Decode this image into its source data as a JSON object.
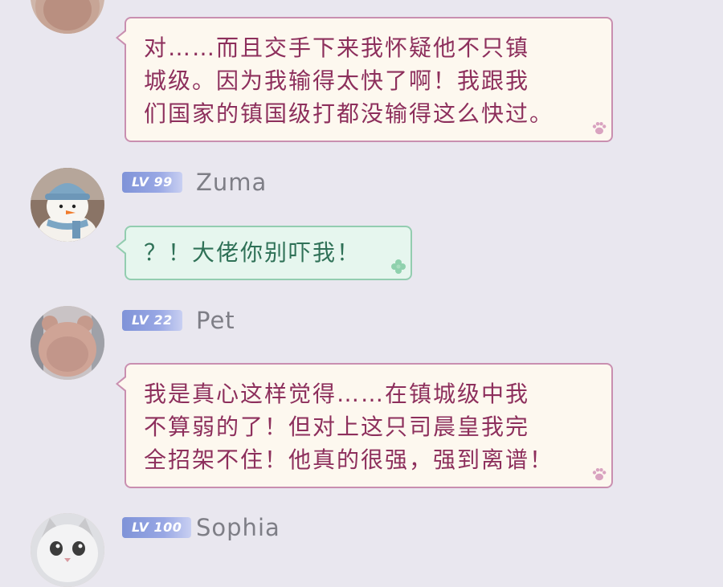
{
  "colors": {
    "background": "#e9e7ef",
    "pink_bubble_bg": "#fdf8ef",
    "pink_bubble_border": "#c98fb0",
    "pink_text": "#8d2f5c",
    "green_bubble_bg": "#e6f6ee",
    "green_bubble_border": "#93cdb0",
    "green_text": "#2f7157",
    "level_badge": "#8a9bdc",
    "username_text": "#7e7e86"
  },
  "messages": [
    {
      "avatar_icon": "bear-avatar-icon",
      "text": "对……而且交手下来我怀疑他不只镇\n城级。因为我输得太快了啊！我跟我\n们国家的镇国级打都没输得这么快过。",
      "style": "pink",
      "corner_icon": "paw-icon"
    },
    {
      "avatar_icon": "snowman-avatar-icon",
      "level": "LV 99",
      "username": "Zuma",
      "text": "？！大佬你别吓我！",
      "style": "green",
      "corner_icon": "clover-icon"
    },
    {
      "avatar_icon": "bear-avatar-icon",
      "level": "LV 22",
      "username": "Pet",
      "text": "我是真心这样觉得……在镇城级中我\n不算弱的了！但对上这只司晨皇我完\n全招架不住！他真的很强，强到离谱！",
      "style": "pink",
      "corner_icon": "paw-icon"
    },
    {
      "avatar_icon": "cat-avatar-icon",
      "level": "LV 100",
      "username": "Sophia"
    }
  ]
}
